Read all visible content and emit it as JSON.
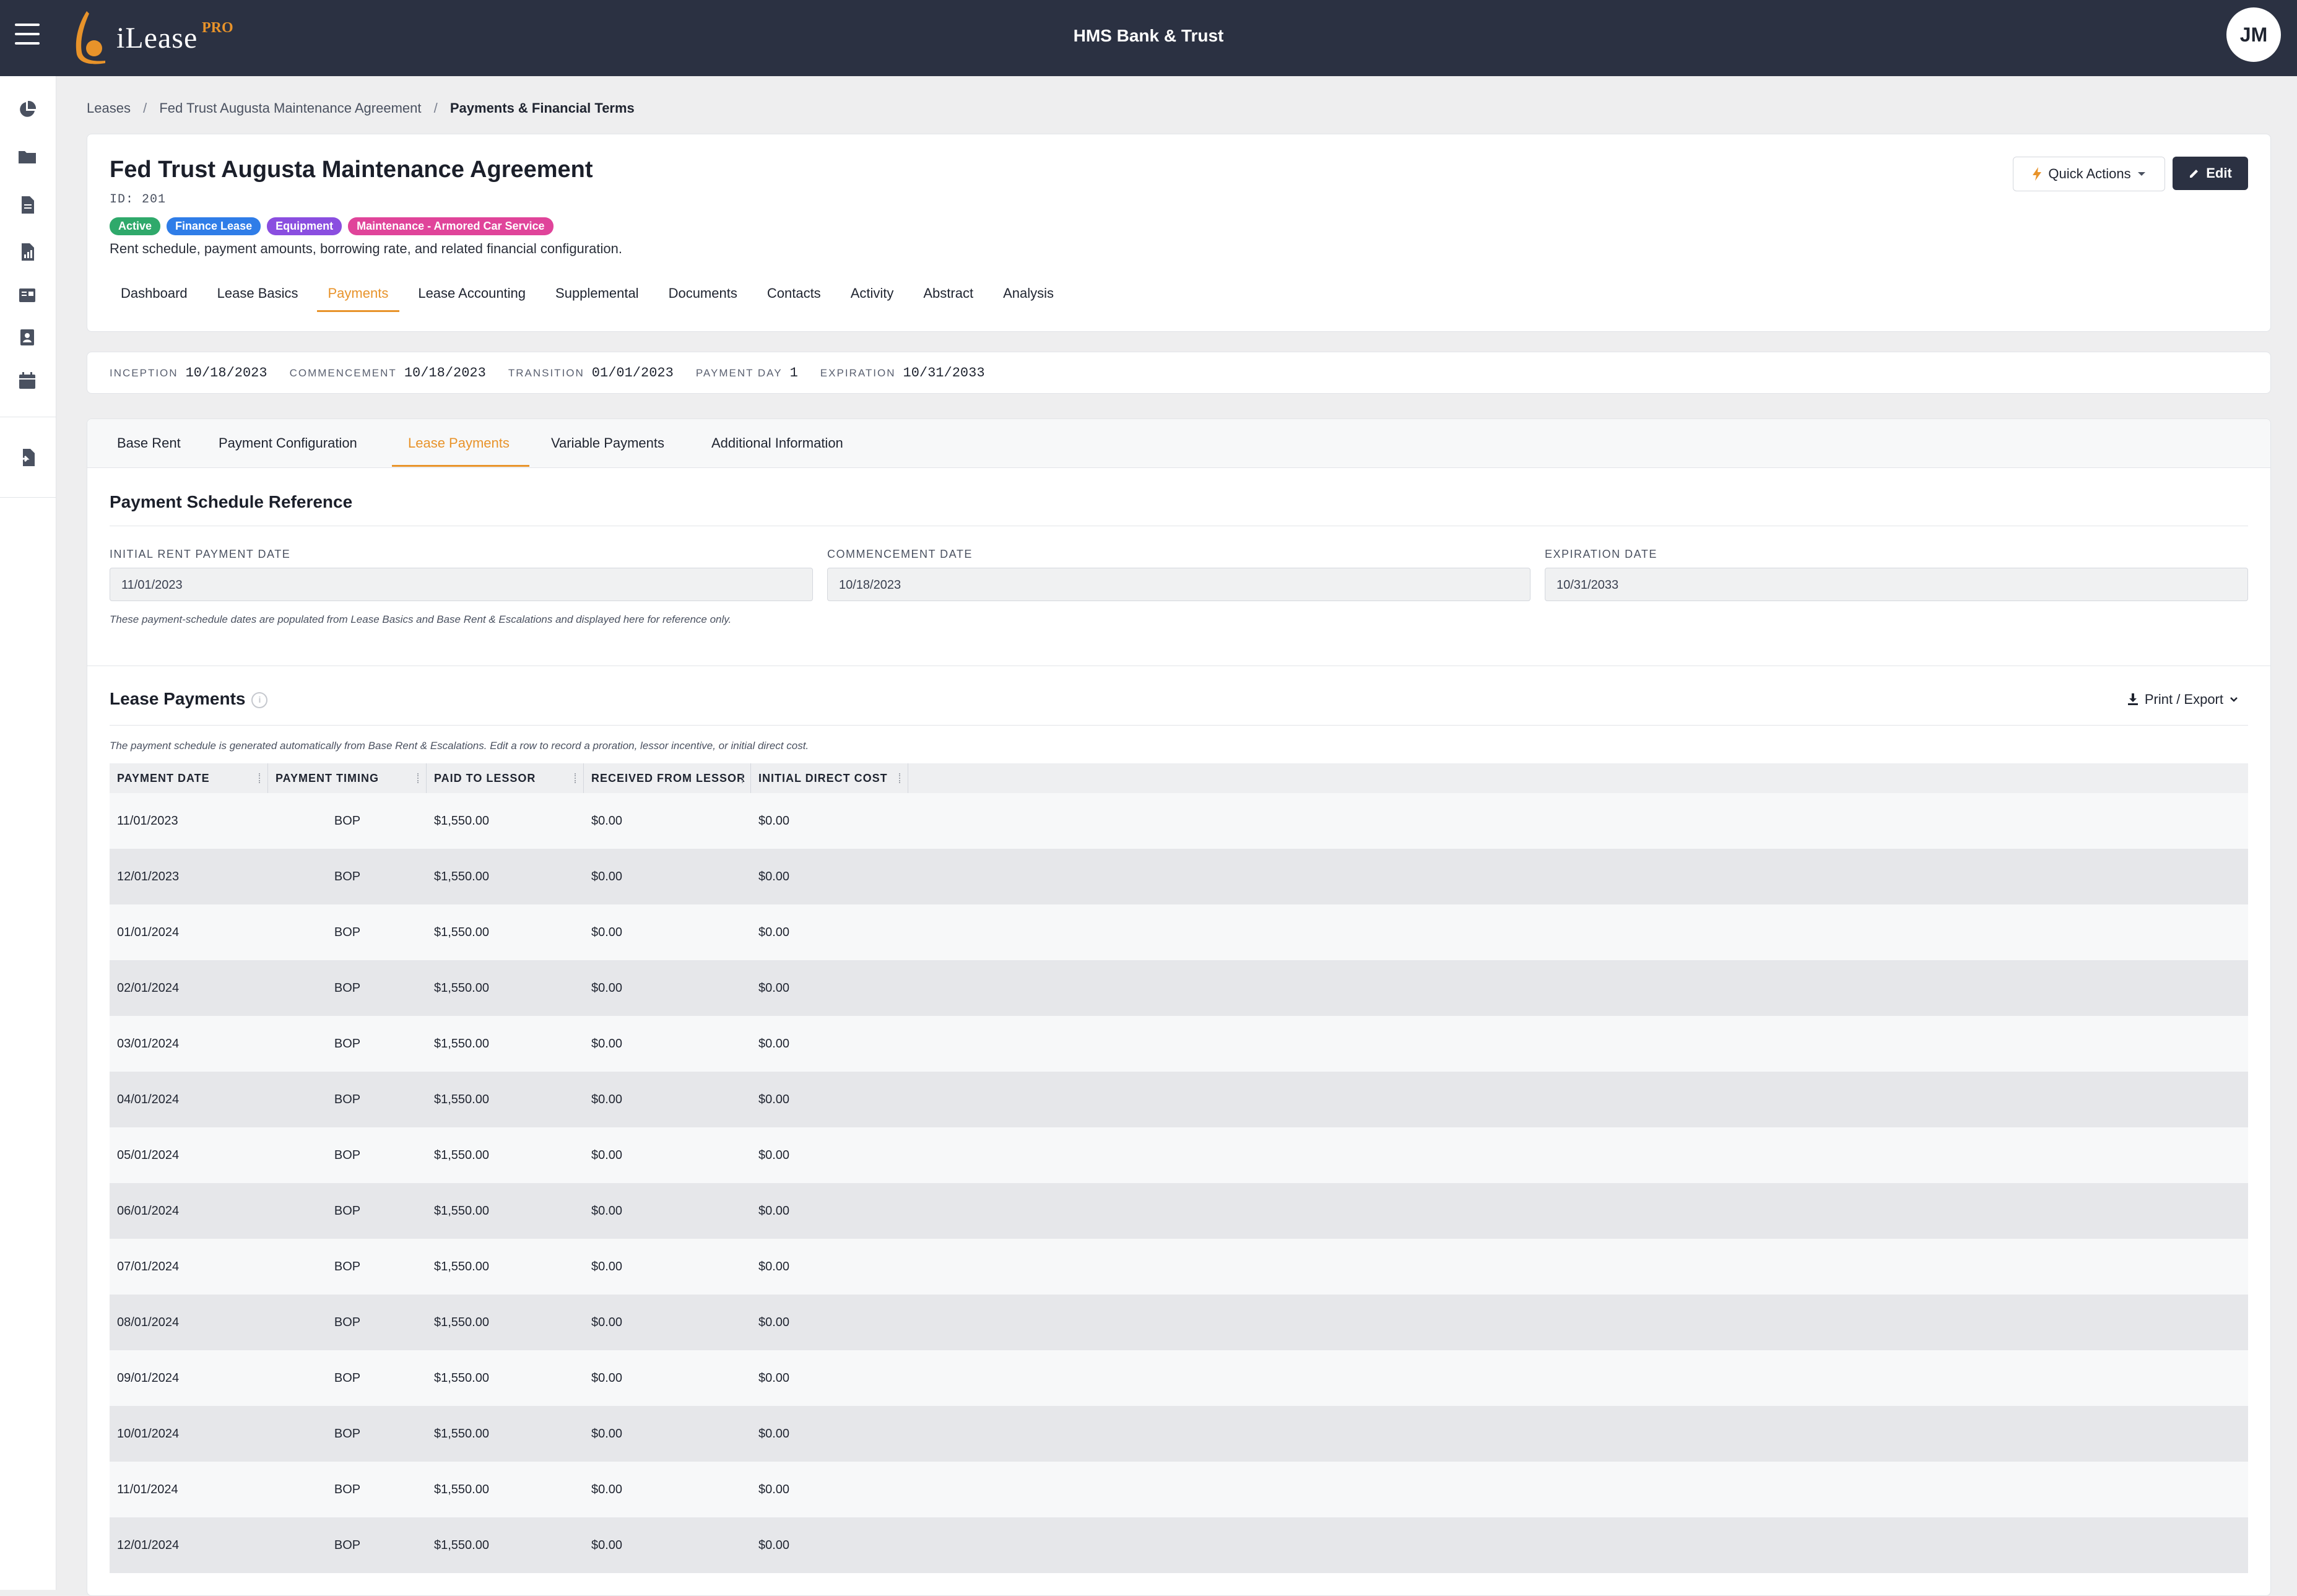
{
  "app": {
    "logo_name": "iLease",
    "logo_pro": "PRO",
    "bank_name": "HMS Bank & Trust",
    "user_initials": "JM"
  },
  "breadcrumb": {
    "items": [
      "Leases",
      "Fed Trust Augusta Maintenance Agreement"
    ],
    "current": "Payments & Financial Terms"
  },
  "lease": {
    "title": "Fed Trust Augusta Maintenance Agreement",
    "id_text": "ID: 201",
    "badges": [
      {
        "label": "Active",
        "color": "#2fa96b"
      },
      {
        "label": "Finance Lease",
        "color": "#2f7de8"
      },
      {
        "label": "Equipment",
        "color": "#8a4ee0"
      },
      {
        "label": "Maintenance - Armored Car Service",
        "color": "#e0449a"
      }
    ],
    "description": "Rent schedule, payment amounts, borrowing rate, and related financial configuration."
  },
  "actions": {
    "quick_actions_label": "Quick Actions",
    "edit_label": "Edit"
  },
  "nav_tabs": [
    "Dashboard",
    "Lease Basics",
    "Payments",
    "Lease Accounting",
    "Supplemental",
    "Documents",
    "Contacts",
    "Activity",
    "Abstract",
    "Analysis"
  ],
  "nav_active": "Payments",
  "key_dates": [
    {
      "label": "Inception",
      "value": "10/18/2023"
    },
    {
      "label": "Commencement",
      "value": "10/18/2023"
    },
    {
      "label": "Transition",
      "value": "01/01/2023"
    },
    {
      "label": "Payment Day",
      "value": "1"
    },
    {
      "label": "Expiration",
      "value": "10/31/2033"
    }
  ],
  "sub_tabs": [
    "Base Rent",
    "Payment Configuration",
    "Lease Payments",
    "Variable Payments",
    "Additional Information"
  ],
  "sub_tab_active": "Lease Payments",
  "schedule_reference": {
    "title": "Payment Schedule Reference",
    "fields": [
      {
        "label": "Initial Rent Payment Date",
        "value": "11/01/2023"
      },
      {
        "label": "Commencement Date",
        "value": "10/18/2023"
      },
      {
        "label": "Expiration Date",
        "value": "10/31/2033"
      }
    ],
    "note": "These payment-schedule dates are populated from Lease Basics and Base Rent & Escalations and displayed here for reference only."
  },
  "lease_payments": {
    "title": "Lease Payments",
    "print_label": "Print / Export",
    "note": "The payment schedule is generated automatically from Base Rent & Escalations. Edit a row to record a proration, lessor incentive, or initial direct cost.",
    "columns": [
      "Payment Date",
      "Payment Timing",
      "Paid to Lessor",
      "Received from Lessor",
      "Initial Direct Cost"
    ],
    "rows": [
      [
        "11/01/2023",
        "BOP",
        "$1,550.00",
        "$0.00",
        "$0.00"
      ],
      [
        "12/01/2023",
        "BOP",
        "$1,550.00",
        "$0.00",
        "$0.00"
      ],
      [
        "01/01/2024",
        "BOP",
        "$1,550.00",
        "$0.00",
        "$0.00"
      ],
      [
        "02/01/2024",
        "BOP",
        "$1,550.00",
        "$0.00",
        "$0.00"
      ],
      [
        "03/01/2024",
        "BOP",
        "$1,550.00",
        "$0.00",
        "$0.00"
      ],
      [
        "04/01/2024",
        "BOP",
        "$1,550.00",
        "$0.00",
        "$0.00"
      ],
      [
        "05/01/2024",
        "BOP",
        "$1,550.00",
        "$0.00",
        "$0.00"
      ],
      [
        "06/01/2024",
        "BOP",
        "$1,550.00",
        "$0.00",
        "$0.00"
      ],
      [
        "07/01/2024",
        "BOP",
        "$1,550.00",
        "$0.00",
        "$0.00"
      ],
      [
        "08/01/2024",
        "BOP",
        "$1,550.00",
        "$0.00",
        "$0.00"
      ],
      [
        "09/01/2024",
        "BOP",
        "$1,550.00",
        "$0.00",
        "$0.00"
      ],
      [
        "10/01/2024",
        "BOP",
        "$1,550.00",
        "$0.00",
        "$0.00"
      ],
      [
        "11/01/2024",
        "BOP",
        "$1,550.00",
        "$0.00",
        "$0.00"
      ],
      [
        "12/01/2024",
        "BOP",
        "$1,550.00",
        "$0.00",
        "$0.00"
      ]
    ]
  },
  "sidebar_icons": [
    "pie-chart-icon",
    "folder-icon",
    "document-icon",
    "report-icon",
    "ledger-icon",
    "contacts-icon",
    "calendar-icon",
    "import-icon"
  ],
  "colors": {
    "accent": "#e8932a",
    "topbar": "#2b3142"
  }
}
